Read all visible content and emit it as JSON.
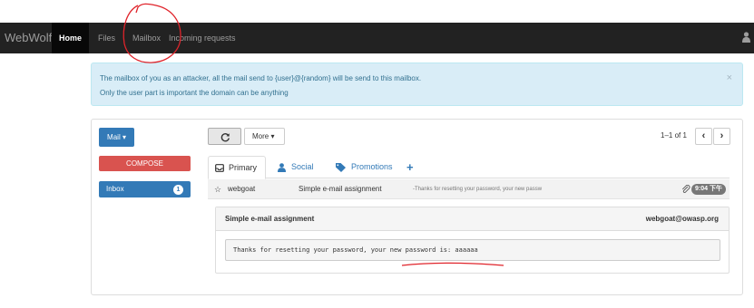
{
  "navbar": {
    "brand": "WebWolf",
    "items": [
      {
        "label": "Home"
      },
      {
        "label": "Files"
      },
      {
        "label": "Mailbox"
      },
      {
        "label": "Incoming requests"
      }
    ]
  },
  "alert": {
    "line1": "The mailbox of you as an attacker, all the mail send to {user}@{random} will be send to this mailbox.",
    "line2": "Only the user part is important the domain can be anything",
    "close": "×"
  },
  "sidebar": {
    "mail_label": "Mail ▾",
    "compose_label": "COMPOSE",
    "inbox_label": "Inbox",
    "inbox_count": "1"
  },
  "toolbar": {
    "more_label": "More ▾",
    "pager_text": "1–1 of 1",
    "prev": "‹",
    "next": "›"
  },
  "tabs": [
    {
      "label": "Primary",
      "icon": "inbox-icon"
    },
    {
      "label": "Social",
      "icon": "user-icon"
    },
    {
      "label": "Promotions",
      "icon": "tag-icon"
    },
    {
      "label": "+",
      "icon": "plus-icon"
    }
  ],
  "mail": {
    "star": "☆",
    "from": "webgoat",
    "subject": "Simple e-mail assignment",
    "snippet": "-Thanks for resetting your password, your new passw",
    "time": "9:04 下午"
  },
  "message": {
    "subject": "Simple e-mail assignment",
    "from_address": "webgoat@owasp.org",
    "body": "Thanks for resetting your password, your new password is: aaaaaa"
  },
  "colors": {
    "navbar": "#222222",
    "primary": "#337ab7",
    "danger": "#d9534f",
    "alert_bg": "#d9edf7",
    "annotation": "#e0242b"
  }
}
